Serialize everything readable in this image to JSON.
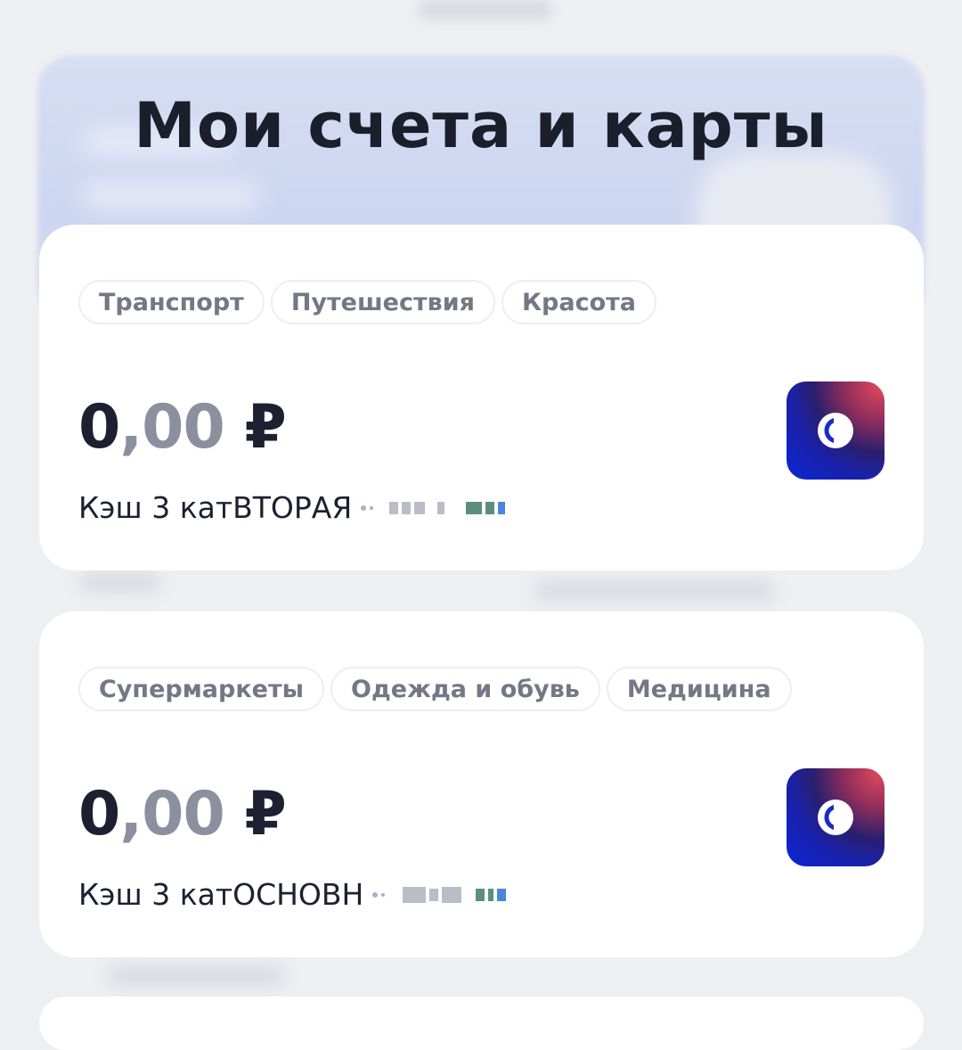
{
  "page": {
    "title": "Мои счета и карты"
  },
  "cards": [
    {
      "categories": [
        "Транспорт",
        "Путешествия",
        "Красота"
      ],
      "balance_int": "0",
      "balance_frac": ",00",
      "currency": "₽",
      "name": "Кэш 3 катВТОРАЯ",
      "logo_icon": "bank-logo-icon"
    },
    {
      "categories": [
        "Супермаркеты",
        "Одежда и обувь",
        "Медицина"
      ],
      "balance_int": "0",
      "balance_frac": ",00",
      "currency": "₽",
      "name": "Кэш 3 катОСНОВН",
      "logo_icon": "bank-logo-icon"
    }
  ],
  "colors": {
    "background": "#eeeff2",
    "card": "#ffffff",
    "text_primary": "#1c2030",
    "text_secondary": "#727884",
    "logo_blue": "#0a26d8",
    "logo_red": "#e0485a"
  }
}
